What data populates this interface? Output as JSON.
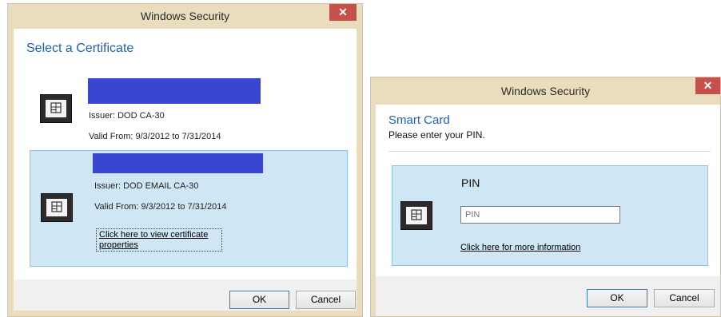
{
  "cert_dialog": {
    "title": "Windows Security",
    "close_glyph": "✕",
    "heading": "Select a Certificate",
    "certificates": [
      {
        "issuer": "Issuer: DOD CA-30",
        "valid": "Valid From: 9/3/2012 to 7/31/2014",
        "selected": false
      },
      {
        "issuer": "Issuer: DOD EMAIL CA-30",
        "valid": "Valid From: 9/3/2012 to 7/31/2014",
        "link_line1": "Click here to view certificate",
        "link_line2": "properties",
        "selected": true
      }
    ],
    "ok_label": "OK",
    "cancel_label": "Cancel"
  },
  "pin_dialog": {
    "title": "Windows Security",
    "close_glyph": "✕",
    "heading": "Smart Card",
    "subheading": "Please enter your PIN.",
    "pin_label": "PIN",
    "pin_placeholder": "PIN",
    "info_link": "Click here for more information",
    "ok_label": "OK",
    "cancel_label": "Cancel"
  },
  "icons": {
    "smart_card": "smart-card-icon",
    "close": "close-icon"
  },
  "colors": {
    "title_bar": "#eaddbd",
    "close_button": "#c7504a",
    "heading_blue": "#1b62b8",
    "selection_fill": "#cfe6f5",
    "selection_border": "#8ec5e3",
    "redaction": "#3b46d0"
  }
}
